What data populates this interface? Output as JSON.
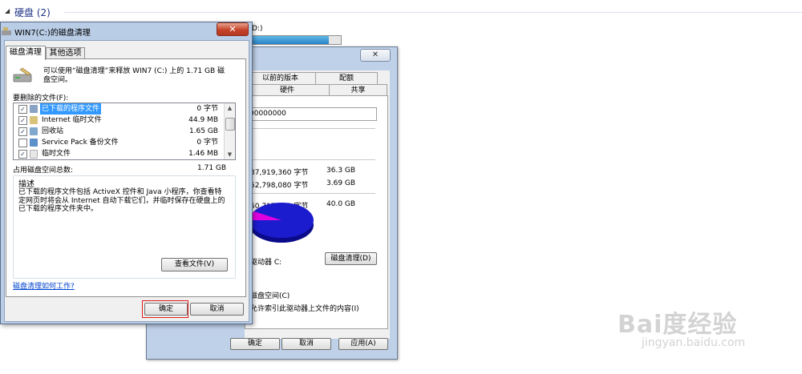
{
  "explorer": {
    "group_title": "硬盘 (2)",
    "drive_label_partial": "D:)",
    "drive_usage_fraction": 0.86
  },
  "properties_dialog": {
    "close_label": "✕",
    "tabs_top": [
      "以前的版本",
      "配额"
    ],
    "tabs_bottom": [
      "硬件",
      "共享"
    ],
    "serial_partial": "00000000",
    "used_bytes_partial": "87,919,360 字节",
    "used_gb": "36.3 GB",
    "free_bytes_partial": "52,798,080 字节",
    "free_gb": "3.69 GB",
    "capacity_bytes_partial": "50,717,440 字节",
    "capacity_gb": "40.0 GB",
    "drive_label_partial": "驱动器 C:",
    "disk_cleanup_button": "磁盘清理(D)",
    "compress_partial": "磁盘空间(C)",
    "index_partial": "允许索引此驱动器上文件的内容(I)",
    "ok": "确定",
    "cancel": "取消",
    "apply": "应用(A)",
    "pie": {
      "used_color": "#1c1ccf",
      "free_color": "#e000e0"
    }
  },
  "cleanup_dialog": {
    "title": "WIN7(C:)的磁盘清理",
    "close_label": "✕",
    "tabs": [
      "磁盘清理",
      "其他选项"
    ],
    "intro": "可以使用“磁盘清理”来释放 WIN7 (C:) 上的 1.71 GB 磁盘空间。",
    "files_label": "要删除的文件(F):",
    "files": [
      {
        "name": "已下载的程序文件",
        "size": "0 字节",
        "checked": true,
        "selected": true,
        "icon_color": "#8aa2c4"
      },
      {
        "name": "Internet 临时文件",
        "size": "44.9 MB",
        "checked": true,
        "selected": false,
        "icon_color": "#d9c27a"
      },
      {
        "name": "回收站",
        "size": "1.65 GB",
        "checked": true,
        "selected": false,
        "icon_color": "#7fa8cc"
      },
      {
        "name": "Service Pack 备份文件",
        "size": "0 字节",
        "checked": false,
        "selected": false,
        "icon_color": "#5a8fc9"
      },
      {
        "name": "临时文件",
        "size": "1.46 MB",
        "checked": true,
        "selected": false,
        "icon_color": "#e8e8e8"
      }
    ],
    "total_label": "占用磁盘空间总数:",
    "total_value": "1.71 GB",
    "description_caption": "描述",
    "description_text": "已下载的程序文件包括 ActiveX 控件和 Java 小程序，你查看特定网页时将会从 Internet 自动下载它们，并临时保存在硬盘上的已下载的程序文件夹中。",
    "view_files": "查看文件(V)",
    "help_link": "磁盘清理如何工作?",
    "ok": "确定",
    "cancel": "取消"
  },
  "watermark": {
    "logo": "Bai度经验",
    "url": "jingyan.baidu.com"
  }
}
